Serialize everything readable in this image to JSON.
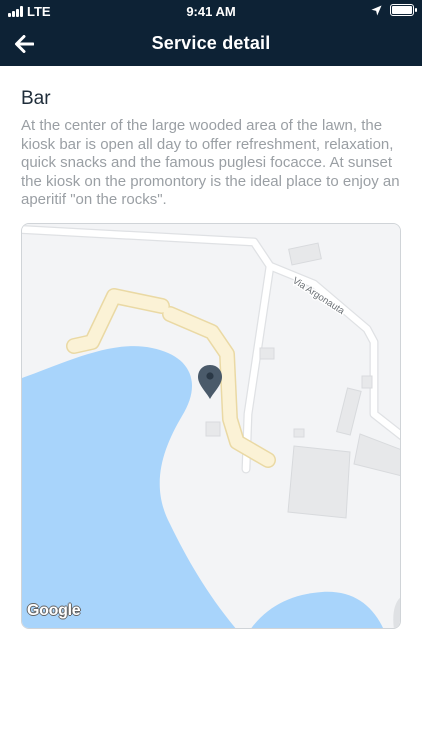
{
  "status_bar": {
    "network": "LTE",
    "time": "9:41 AM"
  },
  "nav": {
    "title": "Service detail",
    "back_icon": "arrow-left-icon"
  },
  "service": {
    "title": "Bar",
    "description": "At the center of the large wooded area of the lawn, the kiosk bar is open all day to offer refreshment, relaxation, quick snacks and the famous puglesi focacce. At sunset the kiosk on the promontory is the ideal place to enjoy an aperitif \"on the rocks\"."
  },
  "map": {
    "street_label": "Via Argonauta",
    "attribution": "Google",
    "marker_icon": "map-pin-icon",
    "colors": {
      "water": "#a8d4fb",
      "land": "#f3f4f6",
      "path": "#fbf2d6",
      "building": "#e7e8ea",
      "road": "#ffffff"
    }
  },
  "colors": {
    "header": "#0d2235",
    "title_text": "#1f2d3a",
    "body_text": "#9a9fa4"
  }
}
